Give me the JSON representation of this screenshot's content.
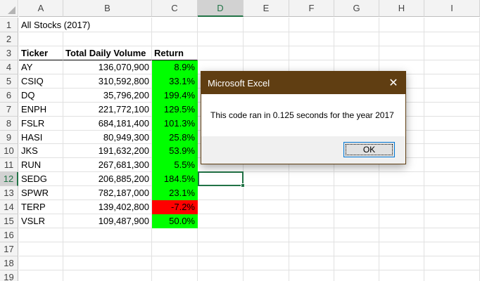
{
  "columns": [
    "A",
    "B",
    "C",
    "D",
    "E",
    "F",
    "G",
    "H",
    "I"
  ],
  "rows": [
    "1",
    "2",
    "3",
    "4",
    "5",
    "6",
    "7",
    "8",
    "9",
    "10",
    "11",
    "12",
    "13",
    "14",
    "15",
    "16",
    "17",
    "18",
    "19"
  ],
  "active_column": "D",
  "active_row": "12",
  "title": "All Stocks (2017)",
  "headers": {
    "ticker": "Ticker",
    "volume": "Total Daily Volume",
    "return": "Return"
  },
  "stocks": [
    {
      "ticker": "AY",
      "volume": "136,070,900",
      "return": "8.9%",
      "status": "positive"
    },
    {
      "ticker": "CSIQ",
      "volume": "310,592,800",
      "return": "33.1%",
      "status": "positive"
    },
    {
      "ticker": "DQ",
      "volume": "35,796,200",
      "return": "199.4%",
      "status": "positive"
    },
    {
      "ticker": "ENPH",
      "volume": "221,772,100",
      "return": "129.5%",
      "status": "positive"
    },
    {
      "ticker": "FSLR",
      "volume": "684,181,400",
      "return": "101.3%",
      "status": "positive"
    },
    {
      "ticker": "HASI",
      "volume": "80,949,300",
      "return": "25.8%",
      "status": "positive"
    },
    {
      "ticker": "JKS",
      "volume": "191,632,200",
      "return": "53.9%",
      "status": "positive"
    },
    {
      "ticker": "RUN",
      "volume": "267,681,300",
      "return": "5.5%",
      "status": "positive"
    },
    {
      "ticker": "SEDG",
      "volume": "206,885,200",
      "return": "184.5%",
      "status": "positive"
    },
    {
      "ticker": "SPWR",
      "volume": "782,187,000",
      "return": "23.1%",
      "status": "positive"
    },
    {
      "ticker": "TERP",
      "volume": "139,402,800",
      "return": "-7.2%",
      "status": "negative"
    },
    {
      "ticker": "VSLR",
      "volume": "109,487,900",
      "return": "50.0%",
      "status": "positive"
    }
  ],
  "colors": {
    "positive": "#00ff00",
    "negative": "#ff0000",
    "dialog_title": "#603e12",
    "selection": "#217346"
  },
  "dialog": {
    "title": "Microsoft Excel",
    "close_icon": "✕",
    "message": "This code ran in 0.125 seconds for the year 2017",
    "ok_label": "OK"
  }
}
